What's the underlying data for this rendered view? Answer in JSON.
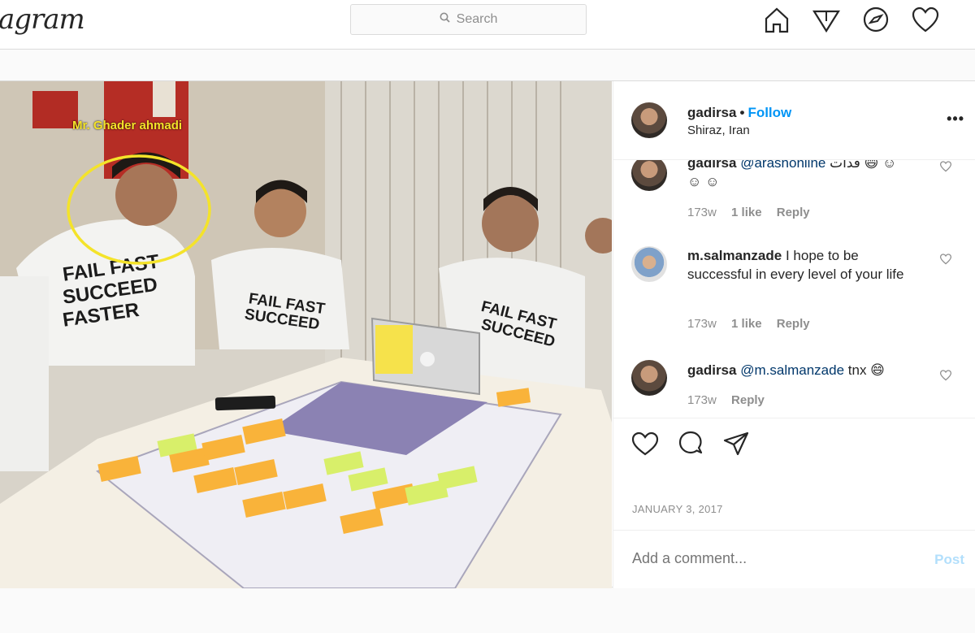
{
  "nav": {
    "logo_text": "agram",
    "search_placeholder": "Search",
    "icons": [
      "home-icon",
      "explore-icon",
      "compass-icon",
      "activity-heart-icon"
    ]
  },
  "photo": {
    "annotation": "Mr. Ghader ahmadi"
  },
  "post_header": {
    "username": "gadirsa",
    "separator": "•",
    "follow_label": "Follow",
    "location": "Shiraz, Iran",
    "more_label": "•••"
  },
  "comments": [
    {
      "username": "gadirsa",
      "mention": "@arashonline",
      "text": "فدات 😄 ☺ ☺ ☺",
      "age": "173w",
      "likes": "1 like",
      "reply": "Reply"
    },
    {
      "username": "m.salmanzade",
      "text": "I hope to be successful in every level of your life",
      "age": "173w",
      "likes": "1 like",
      "reply": "Reply"
    },
    {
      "username": "gadirsa",
      "mention": "@m.salmanzade",
      "text": "tnx 😄",
      "age": "173w",
      "reply": "Reply"
    }
  ],
  "date": "JANUARY 3, 2017",
  "add_comment": {
    "placeholder": "Add a comment...",
    "post_label": "Post"
  },
  "colors": {
    "accent": "#0095f6",
    "post_disabled": "#b2dffc",
    "annotation": "#f4e32a",
    "muted": "#8e8e8e"
  }
}
